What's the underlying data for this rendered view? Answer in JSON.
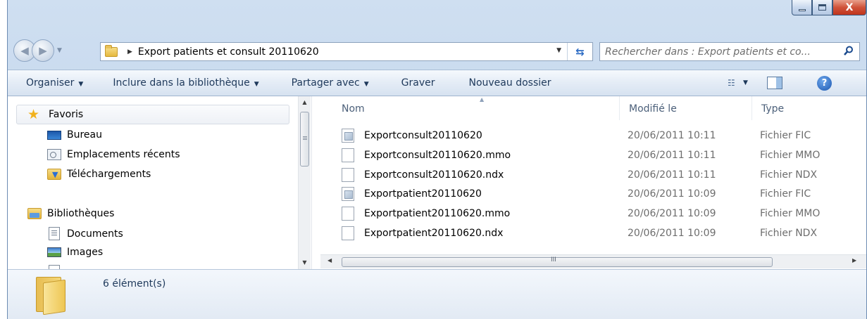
{
  "window": {
    "caption": {
      "minimize_icon": "minimize-icon",
      "maximize_icon": "maximize-icon",
      "close_glyph": "X"
    }
  },
  "nav": {
    "back_glyph": "◀",
    "forward_glyph": "▶"
  },
  "address": {
    "path": "Export patients et consult 20110620"
  },
  "search": {
    "placeholder": "Rechercher dans : Export patients et co..."
  },
  "toolbar": {
    "organize": "Organiser",
    "include_library": "Inclure dans la bibliothèque",
    "share_with": "Partager avec",
    "burn": "Graver",
    "new_folder": "Nouveau dossier",
    "help_glyph": "?"
  },
  "navpane": {
    "favorites": "Favoris",
    "desktop": "Bureau",
    "recent": "Emplacements récents",
    "downloads": "Téléchargements",
    "libraries": "Bibliothèques",
    "documents": "Documents",
    "images": "Images"
  },
  "columns": {
    "name": "Nom",
    "modified": "Modifié le",
    "type": "Type"
  },
  "files": [
    {
      "name": "Exportconsult20110620",
      "modified": "20/06/2011 10:11",
      "type": "Fichier FIC",
      "icon": "fic"
    },
    {
      "name": "Exportconsult20110620.mmo",
      "modified": "20/06/2011 10:11",
      "type": "Fichier MMO",
      "icon": "blank"
    },
    {
      "name": "Exportconsult20110620.ndx",
      "modified": "20/06/2011 10:11",
      "type": "Fichier NDX",
      "icon": "blank"
    },
    {
      "name": "Exportpatient20110620",
      "modified": "20/06/2011 10:09",
      "type": "Fichier FIC",
      "icon": "fic"
    },
    {
      "name": "Exportpatient20110620.mmo",
      "modified": "20/06/2011 10:09",
      "type": "Fichier MMO",
      "icon": "blank"
    },
    {
      "name": "Exportpatient20110620.ndx",
      "modified": "20/06/2011 10:09",
      "type": "Fichier NDX",
      "icon": "blank"
    }
  ],
  "scroll": {
    "hgrip": "III"
  },
  "details": {
    "count": "6 élément(s)"
  }
}
